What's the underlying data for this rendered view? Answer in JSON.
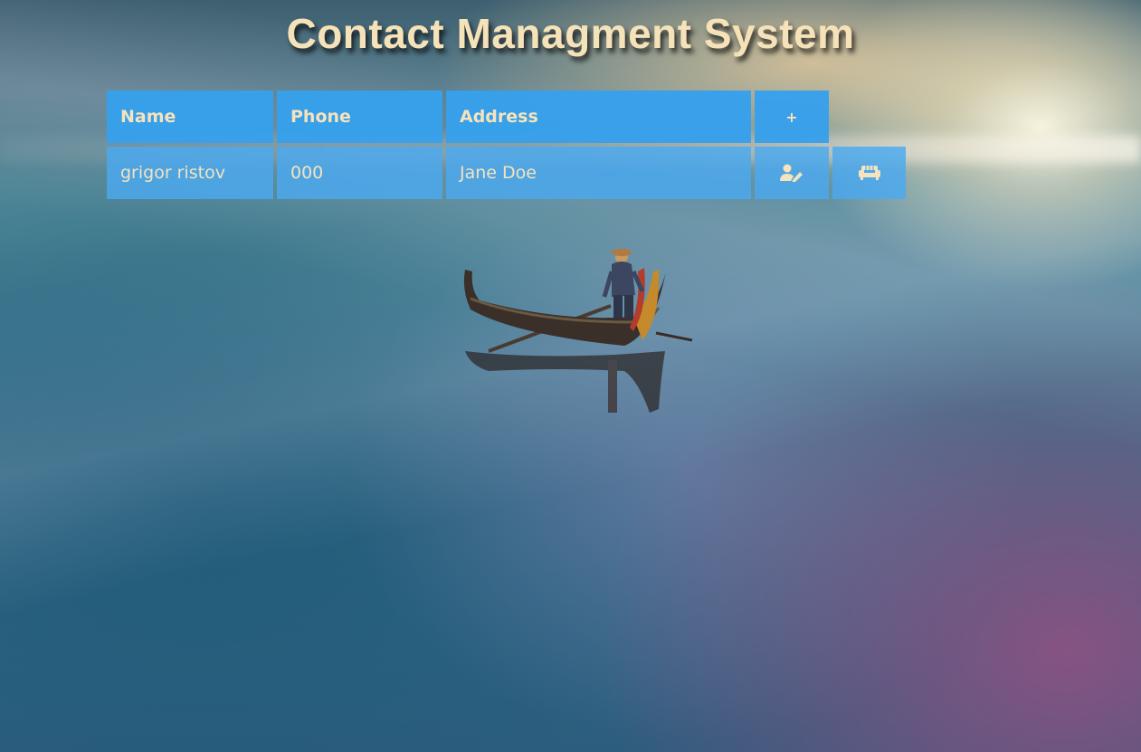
{
  "page": {
    "title": "Contact Managment System"
  },
  "table": {
    "headers": {
      "name": "Name",
      "phone": "Phone",
      "address": "Address",
      "add": "+"
    },
    "rows": [
      {
        "name": "grigor ristov",
        "phone": "000",
        "address": "Jane Doe",
        "edit_icon": "user-edit-icon",
        "delete_icon": "couch-icon"
      }
    ]
  },
  "colors": {
    "header_bg": "#37a0eb",
    "row_bg": "#4baaf0",
    "text": "#f5e3bd"
  }
}
